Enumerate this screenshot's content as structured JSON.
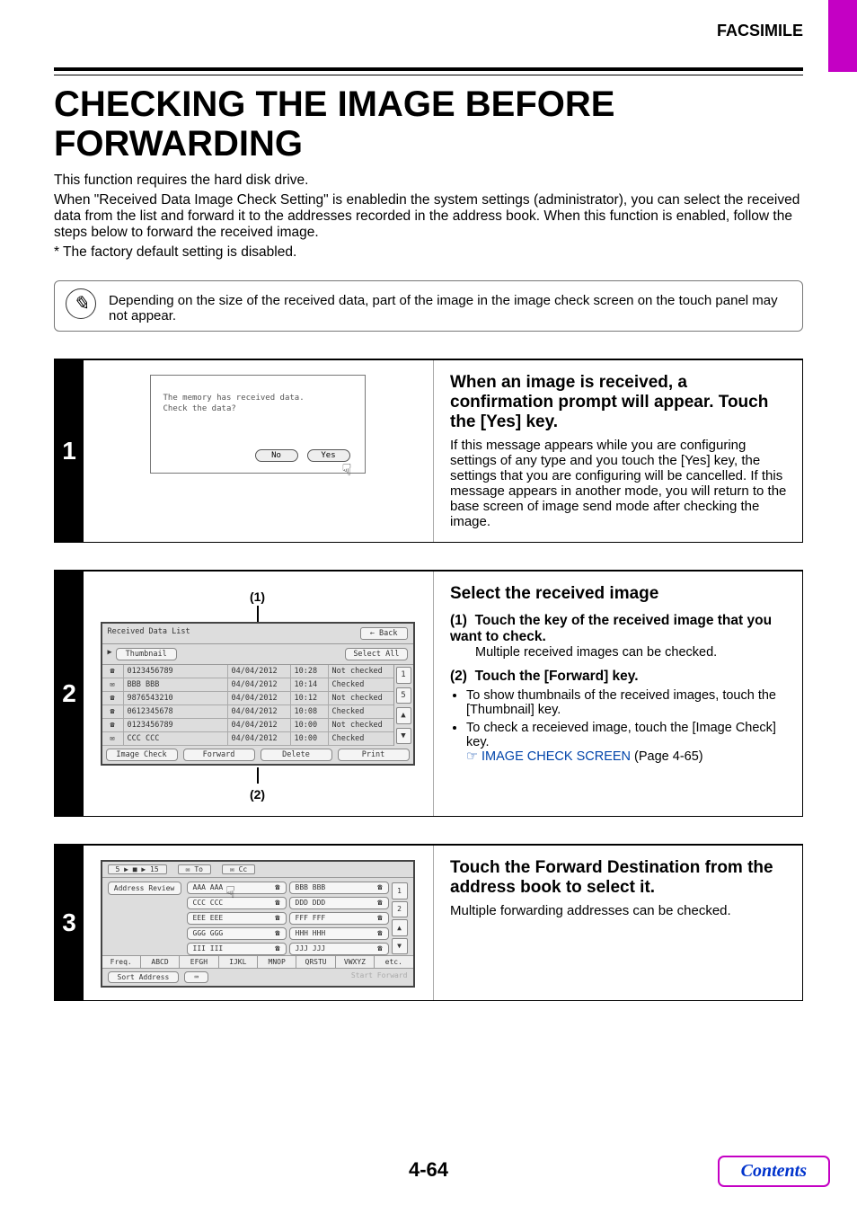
{
  "header": {
    "running_head": "FACSIMILE"
  },
  "title": "CHECKING THE IMAGE BEFORE FORWARDING",
  "intro": {
    "line1": "This function requires the hard disk drive.",
    "line2": "When \"Received Data Image Check Setting\" is enabledin the system settings (administrator), you can select the received data from the list and forward it to the addresses recorded in the address book. When this function is enabled, follow the steps below to forward the received image.",
    "line3": "* The factory default setting is disabled."
  },
  "note": "Depending on the size of the received data, part of the image in the image check screen on the touch panel may not appear.",
  "step1": {
    "num": "1",
    "title": "When an image is received, a confirmation prompt will appear. Touch the [Yes] key.",
    "body": "If this message appears while you are configuring settings of any type and you touch the [Yes] key, the settings that you are configuring will be cancelled. If this message appears in another mode, you will return to the base screen of image send mode after checking the image.",
    "figure": {
      "msg_l1": "The memory has received data.",
      "msg_l2": "Check the data?",
      "no": "No",
      "yes": "Yes"
    }
  },
  "step2": {
    "num": "2",
    "title": "Select the received image",
    "item1_label": "(1)",
    "item1_title": "Touch the key of the received image that you want to check.",
    "item1_body": "Multiple received images can be checked.",
    "item2_label": "(2)",
    "item2_title": "Touch the [Forward] key.",
    "bullet1": "To show thumbnails of the received images, touch the [Thumbnail] key.",
    "bullet2": "To check a receieved image, touch the [Image Check] key.",
    "link": "IMAGE CHECK SCREEN",
    "link_page": "(Page 4-65)",
    "callout1": "(1)",
    "callout2": "(2)",
    "figure": {
      "head_title": "Received Data List",
      "head_back": "Back",
      "thumb": "Thumbnail",
      "selall": "Select All",
      "rows": [
        {
          "no": "0123456789",
          "date": "04/04/2012",
          "time": "10:28",
          "status": "Not checked"
        },
        {
          "no": "BBB BBB",
          "date": "04/04/2012",
          "time": "10:14",
          "status": "Checked"
        },
        {
          "no": "9876543210",
          "date": "04/04/2012",
          "time": "10:12",
          "status": "Not checked"
        },
        {
          "no": "0612345678",
          "date": "04/04/2012",
          "time": "10:08",
          "status": "Checked"
        },
        {
          "no": "0123456789",
          "date": "04/04/2012",
          "time": "10:00",
          "status": "Not checked"
        },
        {
          "no": "CCC CCC",
          "date": "04/04/2012",
          "time": "10:00",
          "status": "Checked"
        }
      ],
      "side": {
        "top": "1",
        "bottom": "5",
        "up": "▲",
        "down": "▼"
      },
      "foot": {
        "imgcheck": "Image Check",
        "forward": "Forward",
        "delete": "Delete",
        "print": "Print"
      }
    }
  },
  "step3": {
    "num": "3",
    "title": "Touch the Forward Destination from the address book to select it.",
    "body": "Multiple forwarding addresses can be checked.",
    "figure": {
      "crumb": "5 ▶ ■ ▶ 15",
      "tab_to": "To",
      "tab_cc": "Cc",
      "side": {
        "review": "Address Review",
        "sort": "Sort Address",
        "count1": "1",
        "count2": "2",
        "up": "▲",
        "down": "▼"
      },
      "rows": [
        [
          "AAA AAA",
          "BBB BBB"
        ],
        [
          "CCC CCC",
          "DDD DDD"
        ],
        [
          "EEE EEE",
          "FFF FFF"
        ],
        [
          "GGG GGG",
          "HHH HHH"
        ],
        [
          "III III",
          "JJJ JJJ"
        ]
      ],
      "alpha": [
        "Freq.",
        "ABCD",
        "EFGH",
        "IJKL",
        "MNOP",
        "QRSTU",
        "VWXYZ",
        "etc."
      ],
      "start": "Start Forward"
    }
  },
  "footer": {
    "page": "4-64",
    "contents": "Contents"
  },
  "icon_glyph": "☎"
}
